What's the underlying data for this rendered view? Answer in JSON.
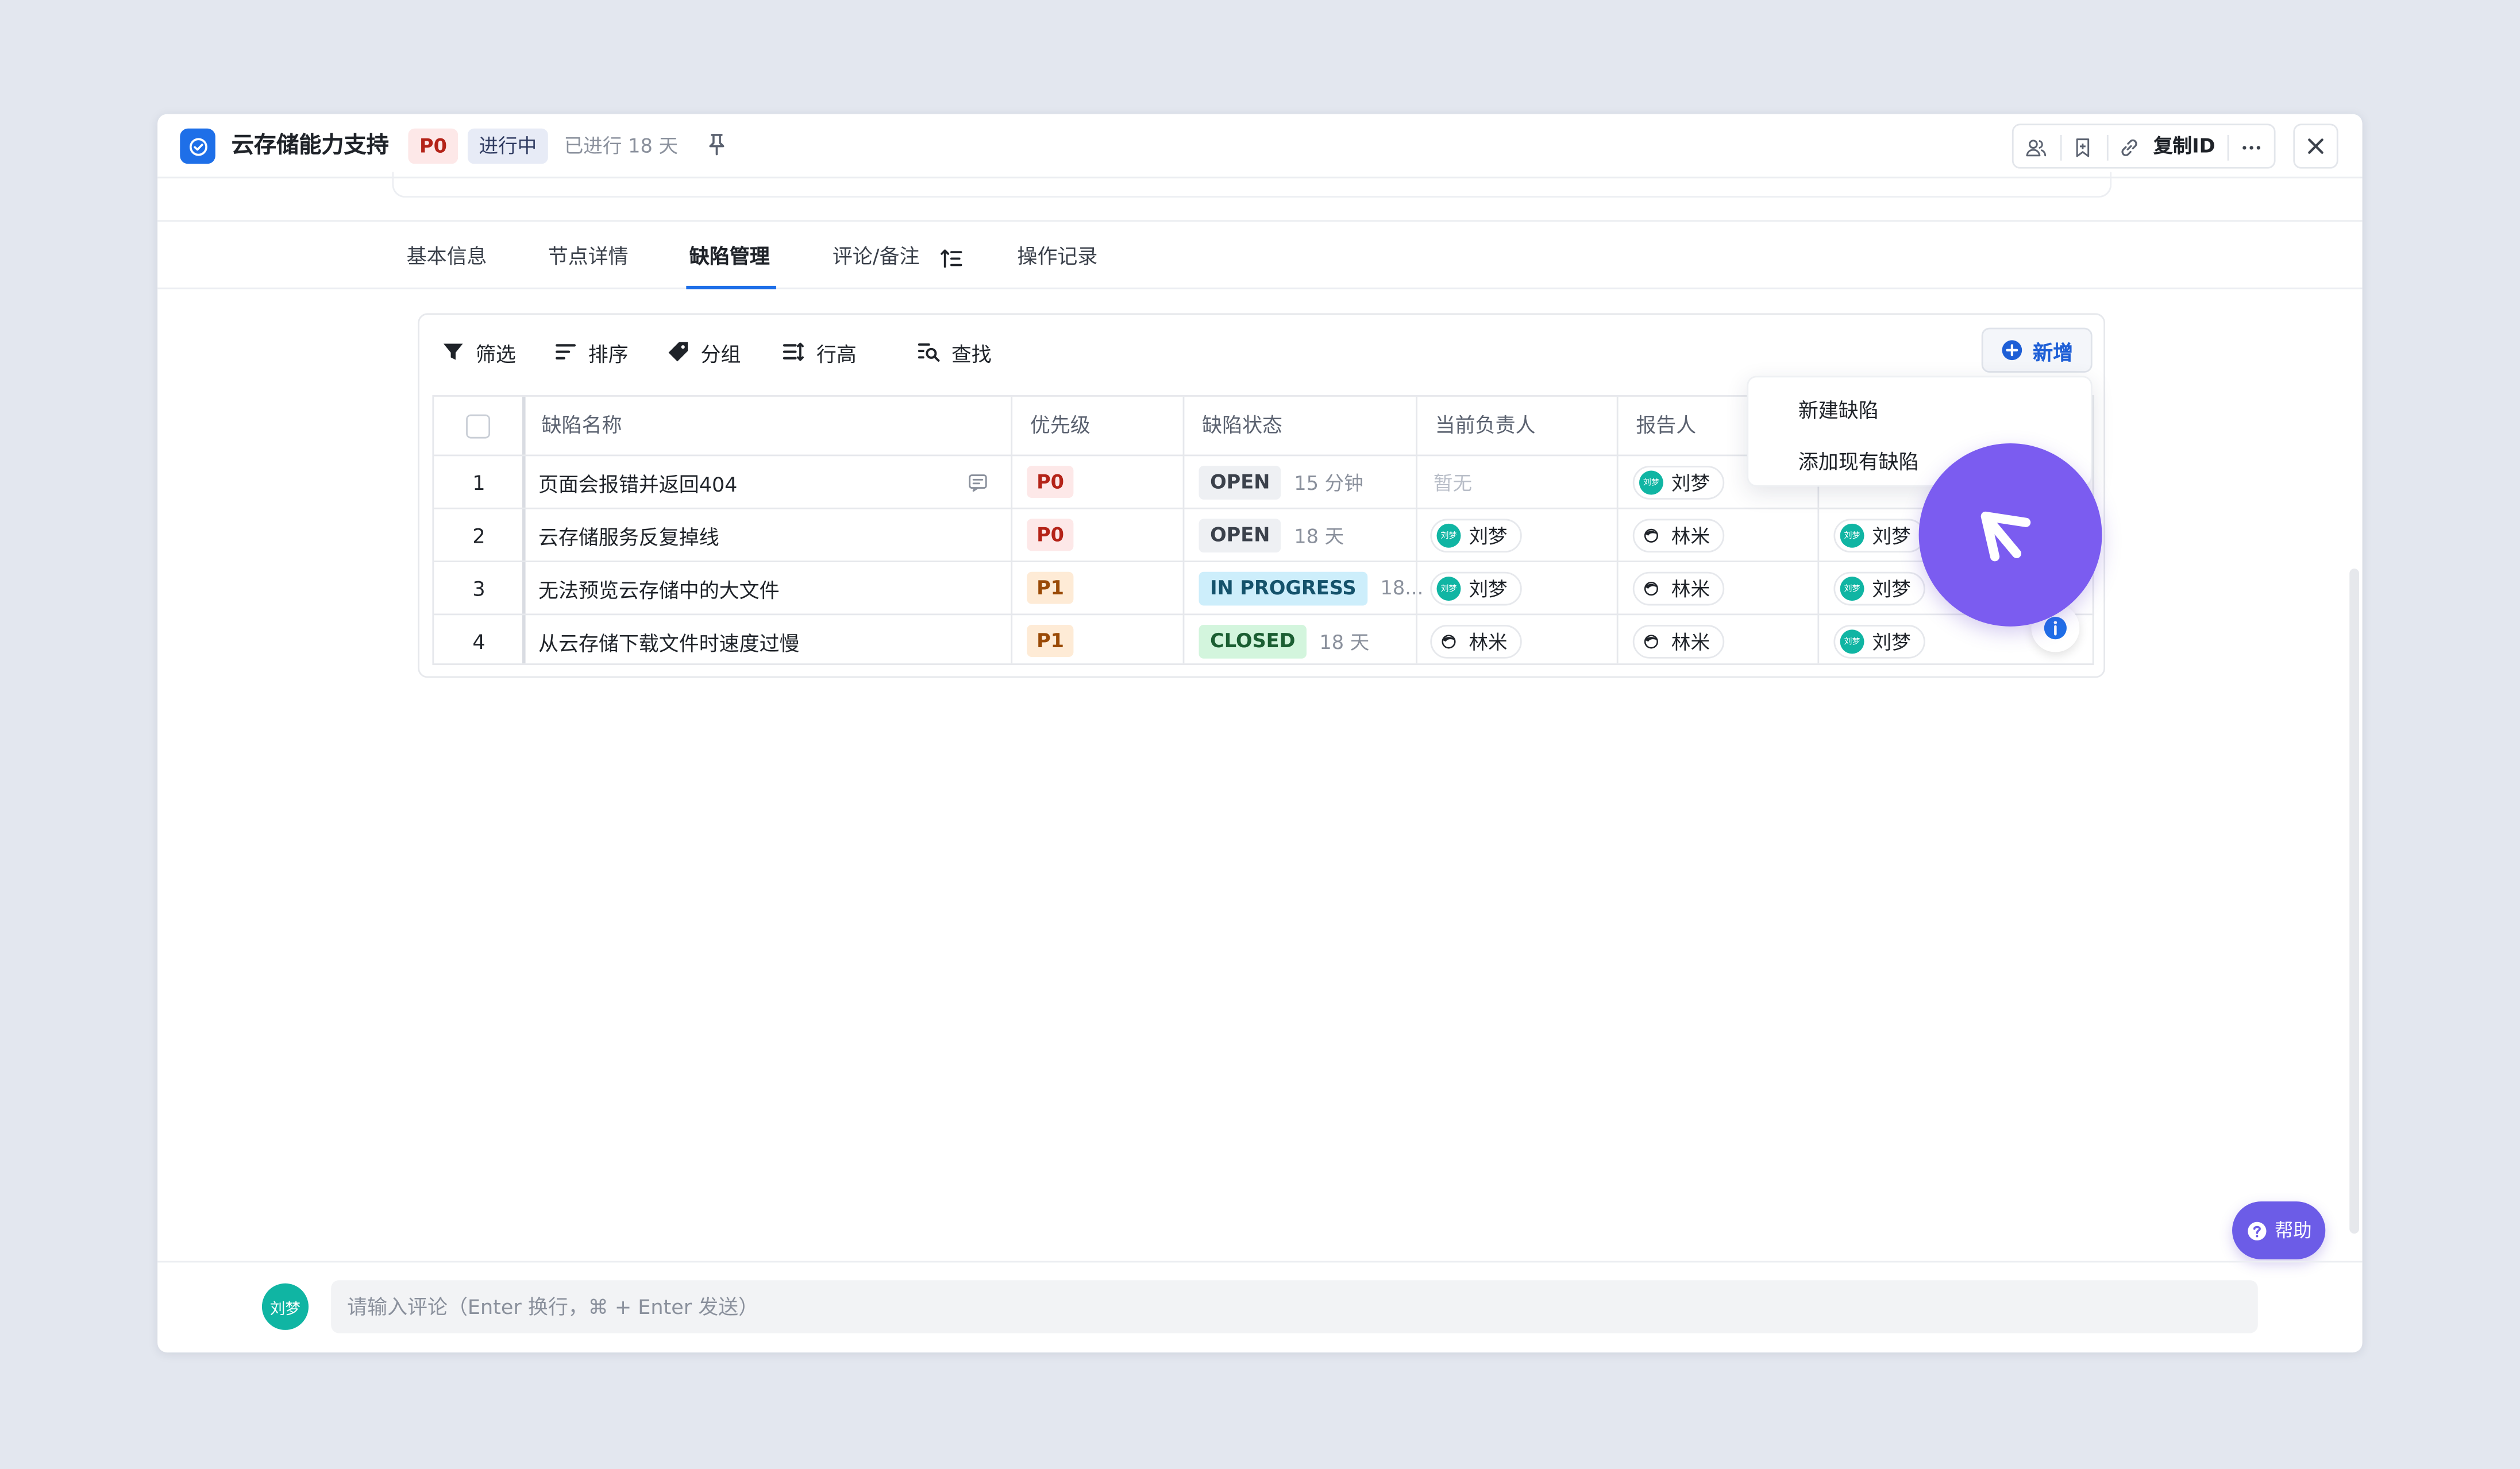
{
  "header": {
    "title": "云存储能力支持",
    "priority": "P0",
    "status": "进行中",
    "elapsed": "已进行 18 天",
    "copy_id_label": "复制ID"
  },
  "tabs": [
    {
      "label": "基本信息"
    },
    {
      "label": "节点详情"
    },
    {
      "label": "缺陷管理"
    },
    {
      "label": "评论/备注"
    },
    {
      "label": "操作记录"
    }
  ],
  "active_tab": "缺陷管理",
  "toolbar": {
    "filter": "筛选",
    "sort": "排序",
    "group": "分组",
    "row_height": "行高",
    "find": "查找",
    "add": "新增"
  },
  "dropdown": {
    "items": [
      "新建缺陷",
      "添加现有缺陷"
    ]
  },
  "table": {
    "columns": [
      "缺陷名称",
      "优先级",
      "缺陷状态",
      "当前负责人",
      "报告人"
    ],
    "rows": [
      {
        "no": "1",
        "name": "页面会报错并返回404",
        "priority": "P0",
        "status": "OPEN",
        "time": "15 分钟",
        "owner": "暂无",
        "reporter": "刘梦",
        "extra": ""
      },
      {
        "no": "2",
        "name": "云存储服务反复掉线",
        "priority": "P0",
        "status": "OPEN",
        "time": "18 天",
        "owner": "刘梦",
        "reporter": "林米",
        "extra": "刘梦"
      },
      {
        "no": "3",
        "name": "无法预览云存储中的大文件",
        "priority": "P1",
        "status": "IN PROGRESS",
        "time": "18...",
        "owner": "刘梦",
        "reporter": "林米",
        "extra": "刘梦"
      },
      {
        "no": "4",
        "name": "从云存储下载文件时速度过慢",
        "priority": "P1",
        "status": "CLOSED",
        "time": "18 天",
        "owner": "林米",
        "reporter": "林米",
        "extra": "刘梦"
      }
    ]
  },
  "help": {
    "label": "帮助"
  },
  "comment": {
    "avatar": "刘梦",
    "placeholder": "请输入评论（Enter 换行，⌘ + Enter 发送）"
  },
  "colors": {
    "background": "#e3e7ef",
    "accent": "#1e6fe8",
    "click_indicator": "#7b5cf0",
    "help_button": "#6c5ce7"
  },
  "icons": [
    "task-icon",
    "pin-icon",
    "members-icon",
    "bookmark-icon",
    "link-icon",
    "more-icon",
    "close-icon",
    "filter-icon",
    "sort-icon",
    "tag-icon",
    "row-height-icon",
    "search-icon",
    "plus-circle-icon",
    "comment-icon",
    "info-icon",
    "help-icon",
    "arrow-up-left-icon"
  ]
}
